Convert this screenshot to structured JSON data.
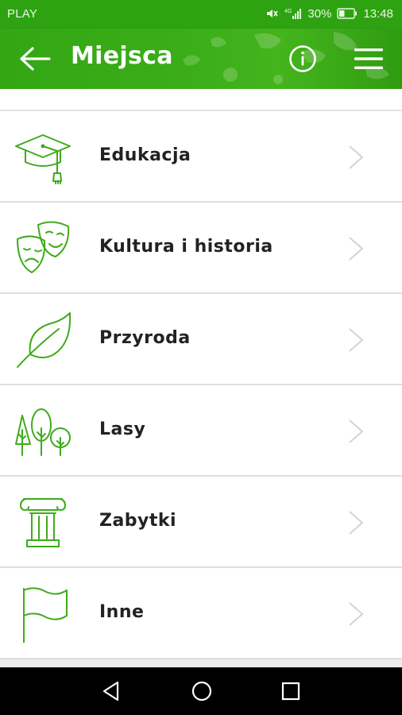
{
  "status_bar": {
    "carrier": "PLAY",
    "battery": "30%",
    "time": "13:48",
    "icons": [
      "mute-icon",
      "signal-icon",
      "battery-icon"
    ]
  },
  "app_bar": {
    "title": "Miejsca",
    "icons": [
      "back-arrow-icon",
      "info-icon",
      "hamburger-menu-icon"
    ]
  },
  "categories": [
    {
      "label": "Edukacja",
      "icon": "graduation-cap-icon"
    },
    {
      "label": "Kultura i historia",
      "icon": "theater-masks-icon"
    },
    {
      "label": "Przyroda",
      "icon": "leaf-icon"
    },
    {
      "label": "Lasy",
      "icon": "trees-icon"
    },
    {
      "label": "Zabytki",
      "icon": "column-icon"
    },
    {
      "label": "Inne",
      "icon": "flag-icon"
    }
  ],
  "nav_bar": {
    "icons": [
      "nav-back-icon",
      "nav-home-icon",
      "nav-recents-icon"
    ]
  },
  "colors": {
    "accent": "#3aad18",
    "icon_stroke": "#3eab1a",
    "text": "#222222",
    "divider": "#dedede"
  }
}
